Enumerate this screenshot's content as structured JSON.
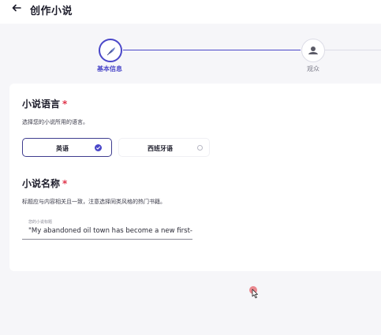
{
  "header": {
    "title": "创作小说"
  },
  "stepper": {
    "steps": [
      {
        "label": "基本信息",
        "icon": "quill-icon",
        "state": "active"
      },
      {
        "label": "观众",
        "icon": "audience-icon",
        "state": "inactive"
      }
    ]
  },
  "language_section": {
    "title": "小说语言",
    "required_mark": "*",
    "description": "选择您的小说所用的语言。",
    "options": [
      {
        "label": "英语",
        "selected": true
      },
      {
        "label": "西班牙语",
        "selected": false
      }
    ]
  },
  "name_section": {
    "title": "小说名称",
    "required_mark": "*",
    "description": "标题应与内容相关且一致，注意选择同类风格的热门书籍。",
    "field_caption": "您的小说标题",
    "field_value": "\"My abandoned oil town has become a new first-tier"
  },
  "colors": {
    "accent": "#4a47c9",
    "required": "#e0344a",
    "cursor_highlight": "#e8747c"
  }
}
